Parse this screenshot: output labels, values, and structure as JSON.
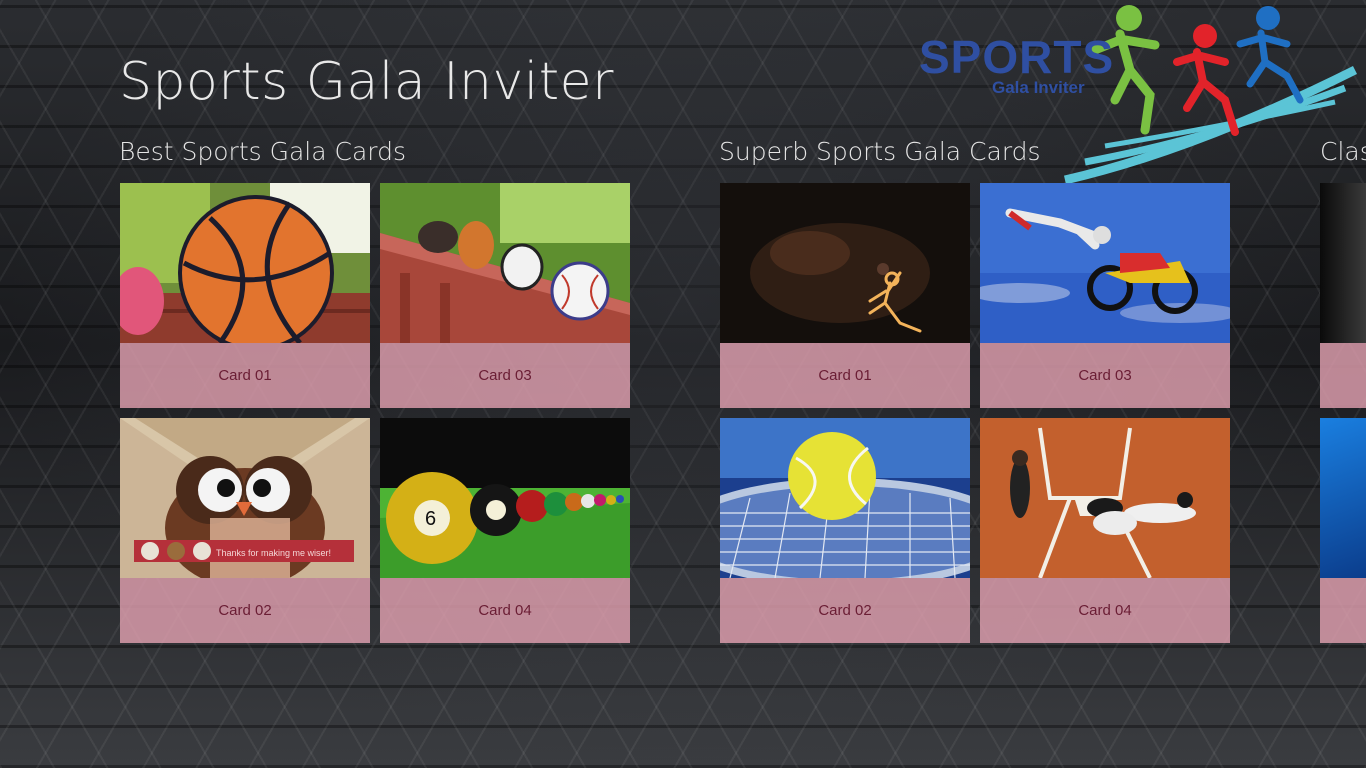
{
  "app": {
    "title": "Sports Gala Inviter"
  },
  "logo": {
    "main_text": "SPORTS",
    "sub_text": "Gala Inviter"
  },
  "groups": [
    {
      "title": "Best Sports Gala Cards",
      "cards": [
        {
          "label": "Card 01",
          "image": "basketball-card"
        },
        {
          "label": "Card 03",
          "image": "sports-balls-on-railing"
        },
        {
          "label": "Card 02",
          "image": "owl-card"
        },
        {
          "label": "Card 04",
          "image": "billiard-balls"
        }
      ]
    },
    {
      "title": "Superb Sports Gala Cards",
      "cards": [
        {
          "label": "Card 01",
          "image": "glowing-basketball-player"
        },
        {
          "label": "Card 03",
          "image": "motocross-jump"
        },
        {
          "label": "Card 02",
          "image": "tennis-ball-racket"
        },
        {
          "label": "Card 04",
          "image": "baseball-slide"
        }
      ]
    },
    {
      "title": "Clas",
      "cards": []
    }
  ],
  "owl_card_text": "Thanks for making me wiser!",
  "colors": {
    "caption_bg": "#e0a0b0",
    "caption_text": "#6a1d34",
    "title_text": "#e8e8e8"
  }
}
